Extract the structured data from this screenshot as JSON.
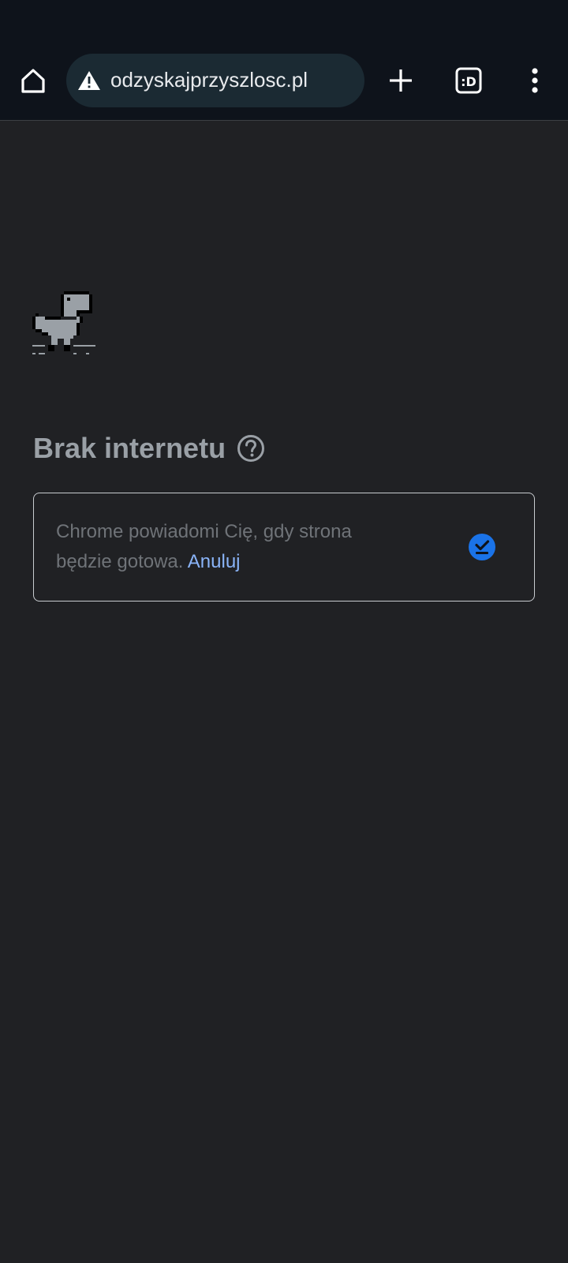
{
  "browser": {
    "url": "odzyskajprzyszlosc.pl",
    "icons": {
      "home": "home-icon",
      "security": "warning-triangle-icon",
      "new_tab": "plus-icon",
      "tab_switcher": "tab-switcher-icon",
      "tab_switcher_label": ":D",
      "menu": "more-vert-icon"
    }
  },
  "page": {
    "title": "Brak internetu",
    "notice": {
      "text": "Chrome powiadomi Cię, gdy strona będzie gotowa.",
      "cancel_label": "Anuluj"
    }
  },
  "colors": {
    "toolbar_bg": "#0e131b",
    "page_bg": "#202124",
    "accent": "#8ab4f8",
    "check": "#1a73e8"
  }
}
